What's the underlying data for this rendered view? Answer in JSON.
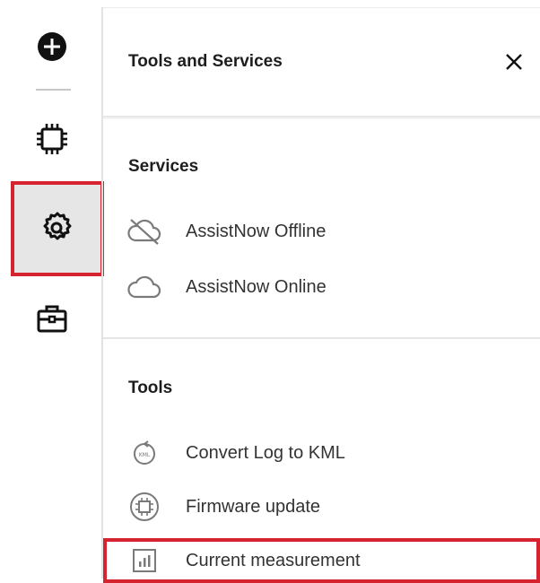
{
  "panel": {
    "title": "Tools and Services",
    "close_icon": "close-icon"
  },
  "rail": {
    "items": [
      {
        "icon": "add-icon",
        "active": false
      },
      {
        "icon": "chip-icon",
        "active": false
      },
      {
        "icon": "tools-services-icon",
        "active": true
      },
      {
        "icon": "briefcase-icon",
        "active": false
      }
    ]
  },
  "sections": {
    "services": {
      "title": "Services",
      "items": [
        {
          "label": "AssistNow Offline",
          "icon": "cloud-offline-icon"
        },
        {
          "label": "AssistNow Online",
          "icon": "cloud-icon"
        }
      ]
    },
    "tools": {
      "title": "Tools",
      "items": [
        {
          "label": "Convert Log to KML",
          "icon": "kml-convert-icon"
        },
        {
          "label": "Firmware update",
          "icon": "firmware-update-icon"
        },
        {
          "label": "Current measurement",
          "icon": "measurement-chart-icon",
          "highlighted": true
        }
      ]
    }
  },
  "colors": {
    "highlight_border": "#d5232f",
    "active_bg": "#e6e6e6",
    "text": "#333333"
  }
}
